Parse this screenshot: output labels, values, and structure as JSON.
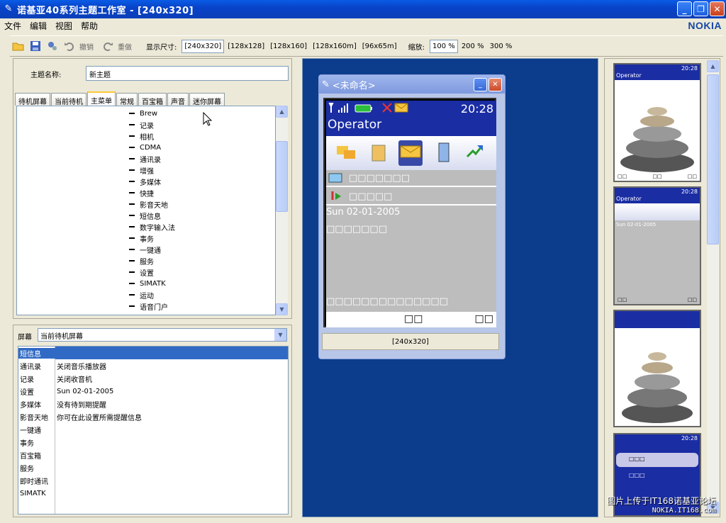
{
  "window": {
    "title": "诺基亚40系列主题工作室 -  [240x320]"
  },
  "menu": [
    "文件",
    "编辑",
    "视图",
    "帮助"
  ],
  "brand": "NOKIA",
  "toolbar": {
    "undo": "撤销",
    "redo": "重做",
    "display_size_label": "显示尺寸:",
    "sizes": [
      "[240x320]",
      "[128x128]",
      "[128x160]",
      "[128x160m]",
      "[96x65m]"
    ],
    "zoom_label": "缩放:",
    "zooms": [
      "100 %",
      "200 %",
      "300 %"
    ]
  },
  "theme": {
    "name_label": "主题名称:",
    "name_value": "新主题"
  },
  "tabs": [
    "待机屏幕",
    "当前待机",
    "主菜单",
    "常规",
    "百宝箱",
    "声音",
    "迷你屏幕"
  ],
  "tree_items": [
    "Brew",
    "记录",
    "相机",
    "CDMA",
    "通讯录",
    "增强",
    "多媒体",
    "快捷",
    "影音天地",
    "短信息",
    "数字输入法",
    "事务",
    "一键通",
    "服务",
    "设置",
    "SIMATK",
    "运动",
    "语音门户"
  ],
  "screen_select": {
    "label": "屏幕",
    "value": "当前待机屏幕"
  },
  "grid_rows": [
    {
      "k": "短信息",
      "v": ""
    },
    {
      "k": "通讯录",
      "v": "关闭音乐播放器"
    },
    {
      "k": "记录",
      "v": "关闭收音机"
    },
    {
      "k": "设置",
      "v": "Sun 02-01-2005"
    },
    {
      "k": "多媒体",
      "v": "没有待到期提醒"
    },
    {
      "k": "影音天地",
      "v": "你可在此设置所需提醒信息"
    },
    {
      "k": "一键通",
      "v": ""
    },
    {
      "k": "事务",
      "v": ""
    },
    {
      "k": "百宝箱",
      "v": ""
    },
    {
      "k": "服务",
      "v": ""
    },
    {
      "k": "即时通讯",
      "v": ""
    },
    {
      "k": "SIMATK",
      "v": ""
    }
  ],
  "phone": {
    "window_title": "<未命名>",
    "time": "20:28",
    "operator": "Operator",
    "date": "Sun 02-01-2005",
    "caption": "[240x320]",
    "row1": "□□□□□□□",
    "row2": "□□□□□",
    "note": "□□□□□□□",
    "message": "□□□□□□□□□□□□□□",
    "soft_left": "□□",
    "soft_right": "□□",
    "selected_icon_label": "□□□"
  },
  "thumbs": {
    "t1": {
      "time": "20:28",
      "op": "Operator",
      "l": "□□",
      "m": "□□",
      "r": "□□"
    },
    "t2": {
      "time": "20:28",
      "op": "Operator",
      "date": "Sun 02-01-2005",
      "l": "□□",
      "r": "□□"
    },
    "t4": {
      "time": "20:28",
      "a": "□□□",
      "b": "□□□"
    }
  },
  "watermark": {
    "line1": "图片上传于IT168诺基亚论坛",
    "line2": "NOKIA.IT168.com"
  }
}
